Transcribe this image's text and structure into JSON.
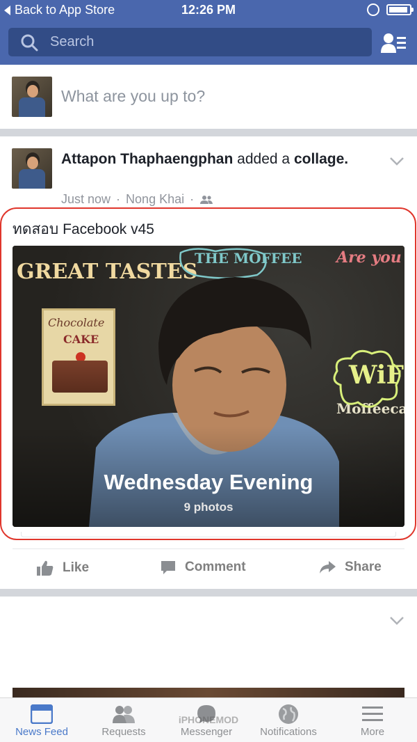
{
  "status_bar": {
    "back_label": "Back to App Store",
    "time": "12:26 PM"
  },
  "header": {
    "search_placeholder": "Search"
  },
  "composer": {
    "prompt": "What are you up to?"
  },
  "post": {
    "author": "Attapon Thaphaengphan",
    "action_text": "added a",
    "action_object": "collage.",
    "time": "Just now",
    "location": "Nong Khai",
    "dot": "·",
    "text": "ทดสอบ Facebook v45",
    "collage": {
      "title": "Wednesday Evening",
      "count": "9 photos",
      "chalk": {
        "great_tastes": "GREAT  TASTES",
        "the_moffee": "THE MOFFEE",
        "are_you": "Are you",
        "wifi": "WiFi",
        "moffeecafe": "Moffeeca",
        "chocolate": "Chocolate",
        "cake": "CAKE"
      }
    },
    "actions": {
      "like": "Like",
      "comment": "Comment",
      "share": "Share"
    }
  },
  "tabbar": {
    "tabs": [
      {
        "label": "News Feed",
        "icon": "news-feed-icon",
        "active": true
      },
      {
        "label": "Requests",
        "icon": "friend-requests-icon",
        "active": false
      },
      {
        "label": "Messenger",
        "icon": "messenger-icon",
        "active": false
      },
      {
        "label": "Notifications",
        "icon": "globe-icon",
        "active": false
      },
      {
        "label": "More",
        "icon": "menu-icon",
        "active": false
      }
    ]
  },
  "watermark": "iPHONEMOD",
  "colors": {
    "brand": "#4a67ad",
    "highlight": "#e0362c",
    "active_tab": "#4a79c9"
  }
}
